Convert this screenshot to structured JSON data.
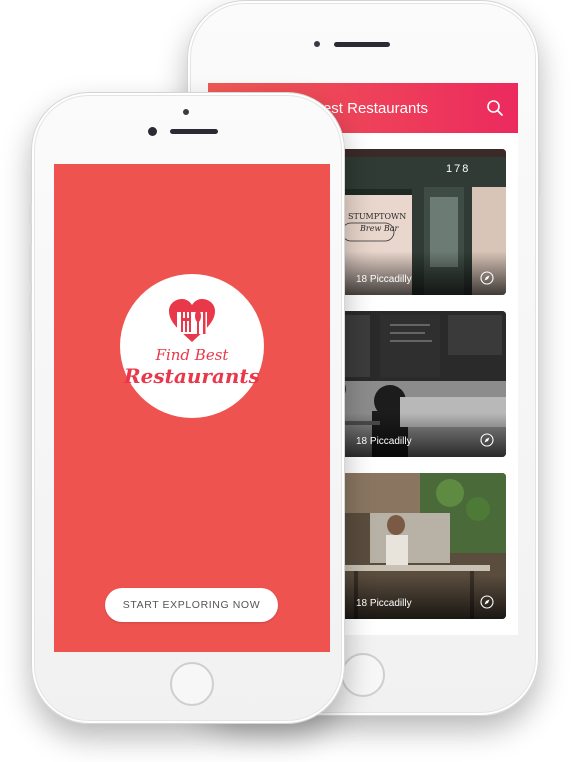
{
  "back_phone": {
    "header": {
      "title": "Best Restaurants",
      "search_icon": "search-icon"
    },
    "restaurants": [
      {
        "storefront_sign": "178",
        "address": "18 Piccadilly",
        "action_icon": "compass-icon"
      },
      {
        "address": "18 Piccadilly",
        "action_icon": "compass-icon"
      },
      {
        "address": "18 Piccadilly",
        "action_icon": "compass-icon"
      }
    ]
  },
  "front_phone": {
    "logo": {
      "line1": "Find Best",
      "line2": "Restaurants"
    },
    "cta_label": "START EXPLORING NOW"
  },
  "colors": {
    "brand_red": "#ee5350",
    "header_gradient_end": "#ec2a5e"
  }
}
